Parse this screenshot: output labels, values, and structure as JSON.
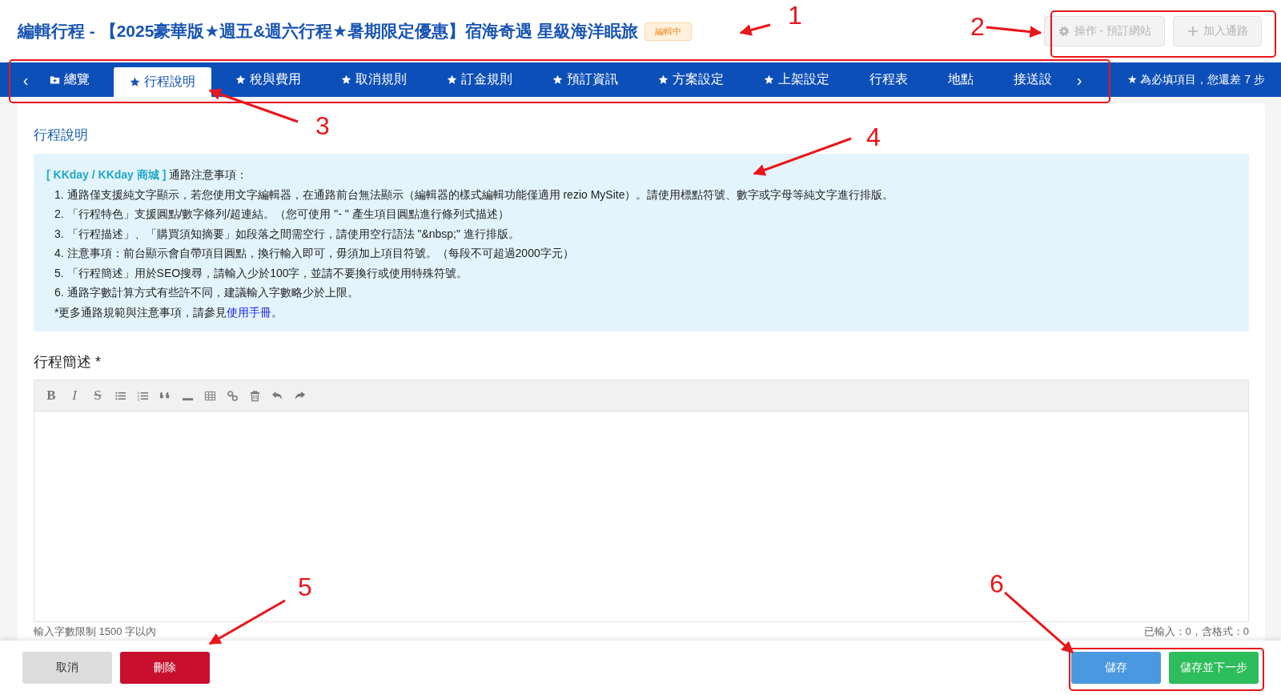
{
  "header": {
    "title": "編輯行程 - 【2025豪華版★週五&週六行程★暑期限定優惠】宿海奇遇 星級海洋眠旅",
    "status_badge": "編輯中",
    "buttons": [
      {
        "kind": "gear",
        "label": "操作 - 預訂網站",
        "disabled": true
      },
      {
        "kind": "plus",
        "label": "加入通路",
        "disabled": true
      }
    ]
  },
  "tabs": [
    {
      "label": "總覽",
      "kind": "folder",
      "selected": false
    },
    {
      "label": "行程說明",
      "kind": "star",
      "selected": true
    },
    {
      "label": "稅與費用",
      "kind": "star",
      "selected": false
    },
    {
      "label": "取消規則",
      "kind": "star",
      "selected": false
    },
    {
      "label": "訂金規則",
      "kind": "star",
      "selected": false
    },
    {
      "label": "預訂資訊",
      "kind": "star",
      "selected": false
    },
    {
      "label": "方案設定",
      "kind": "star",
      "selected": false
    },
    {
      "label": "上架設定",
      "kind": "star",
      "selected": false
    },
    {
      "label": "行程表",
      "kind": "plain",
      "selected": false
    },
    {
      "label": "地點",
      "kind": "plain",
      "selected": false
    },
    {
      "label": "接送設",
      "kind": "plain",
      "selected": false
    }
  ],
  "tabs_prev": "‹",
  "tabs_next": "›",
  "required_note": "★ 為必填項目，您還差 7 步",
  "section_title": "行程說明",
  "notice": {
    "tag": "[ KKday / KKday 商城 ]",
    "heading": "通路注意事項：",
    "items": [
      "1. 通路僅支援純文字顯示，若您使用文字編輯器，在通路前台無法顯示（編輯器的樣式編輯功能僅適用 rezio MySite）。請使用標點符號、數字或字母等純文字進行排版。",
      "2. 「行程特色」支援圓點/數字條列/超連結。（您可使用 \"- \" 產生項目圓點進行條列式描述）",
      "3. 「行程描述」、「購買須知摘要」如段落之間需空行，請使用空行語法 \"&nbsp;\" 進行排版。",
      "4. 注意事項：前台顯示會自帶項目圓點，換行輸入即可，毋須加上項目符號。（每段不可超過2000字元）",
      "5. 「行程簡述」用於SEO搜尋，請輸入少於100字，並請不要換行或使用特殊符號。",
      "6. 通路字數計算方式有些許不同，建議輸入字數略少於上限。"
    ],
    "footer_text": "*更多通路規範與注意事項，請參見",
    "footer_link": "使用手冊",
    "footer_end": "。"
  },
  "editor": {
    "label": "行程簡述 *",
    "tools": [
      {
        "kind": "bold",
        "glyph": "B"
      },
      {
        "kind": "italic",
        "glyph": "I"
      },
      {
        "kind": "strike",
        "glyph": "S"
      },
      {
        "kind": "bullets"
      },
      {
        "kind": "numbers"
      },
      {
        "kind": "quote"
      },
      {
        "kind": "rule"
      },
      {
        "kind": "table"
      },
      {
        "kind": "link"
      },
      {
        "kind": "trash"
      },
      {
        "kind": "undo"
      },
      {
        "kind": "redo"
      }
    ],
    "limit_text": "輸入字數限制 1500 字以內",
    "count_text": "已輸入：0，含格式：0"
  },
  "footer_buttons": [
    {
      "kind": "cancel",
      "label": "取消"
    },
    {
      "kind": "delete",
      "label": "刪除"
    },
    {
      "kind": "save",
      "label": "儲存"
    },
    {
      "kind": "save_next",
      "label": "儲存並下一步"
    }
  ],
  "annotations": [
    {
      "label": "1"
    },
    {
      "label": "2"
    },
    {
      "label": "3"
    },
    {
      "label": "4"
    },
    {
      "label": "5"
    },
    {
      "label": "6"
    }
  ]
}
